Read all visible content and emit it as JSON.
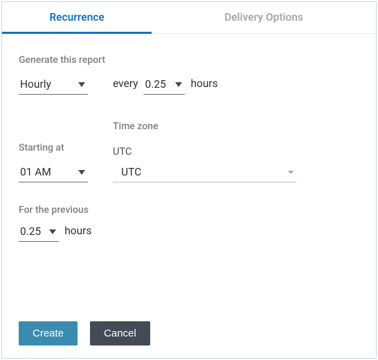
{
  "tabs": {
    "recurrence": "Recurrence",
    "delivery": "Delivery Options"
  },
  "generate": {
    "label": "Generate this report",
    "frequency": "Hourly",
    "everyPrefix": "every",
    "everyValue": "0.25",
    "everyUnit": "hours"
  },
  "starting": {
    "label": "Starting at",
    "value": "01 AM"
  },
  "timezone": {
    "label": "Time zone",
    "value": "UTC",
    "select": "UTC"
  },
  "previous": {
    "label": "For the previous",
    "value": "0.25",
    "unit": "hours"
  },
  "buttons": {
    "create": "Create",
    "cancel": "Cancel"
  }
}
